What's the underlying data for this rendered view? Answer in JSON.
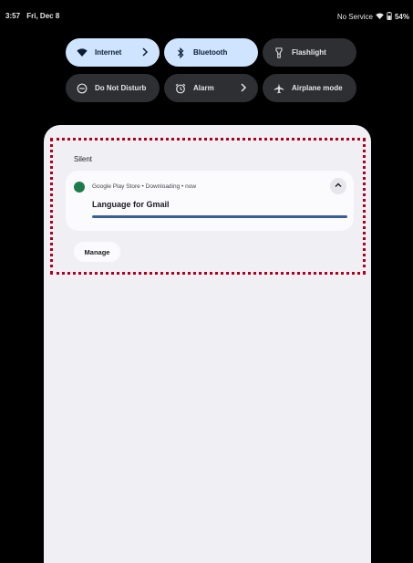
{
  "status_bar": {
    "time": "3:57",
    "date": "Fri, Dec 8",
    "network": "No Service",
    "battery": "54%"
  },
  "quick_settings": [
    {
      "label": "Internet",
      "icon": "wifi-icon",
      "active": true,
      "has_chevron": true
    },
    {
      "label": "Bluetooth",
      "icon": "bluetooth-icon",
      "active": true,
      "has_chevron": false
    },
    {
      "label": "Flashlight",
      "icon": "flashlight-icon",
      "active": false,
      "has_chevron": false
    },
    {
      "label": "Do Not Disturb",
      "icon": "dnd-icon",
      "active": false,
      "has_chevron": false
    },
    {
      "label": "Alarm",
      "icon": "alarm-icon",
      "active": false,
      "has_chevron": true
    },
    {
      "label": "Airplane mode",
      "icon": "airplane-icon",
      "active": false,
      "has_chevron": false
    }
  ],
  "notifications": {
    "section_label": "Silent",
    "card": {
      "app_meta": "Google Play Store • Downloading • now",
      "title": "Language for Gmail",
      "progress": 1.0
    },
    "manage_label": "Manage"
  },
  "colors": {
    "tile_active": "#cfe4ff",
    "tile_inactive": "#2d2f33",
    "shade_bg": "#f0eff4",
    "progress": "#3b5f8f",
    "highlight": "#b1001f"
  }
}
